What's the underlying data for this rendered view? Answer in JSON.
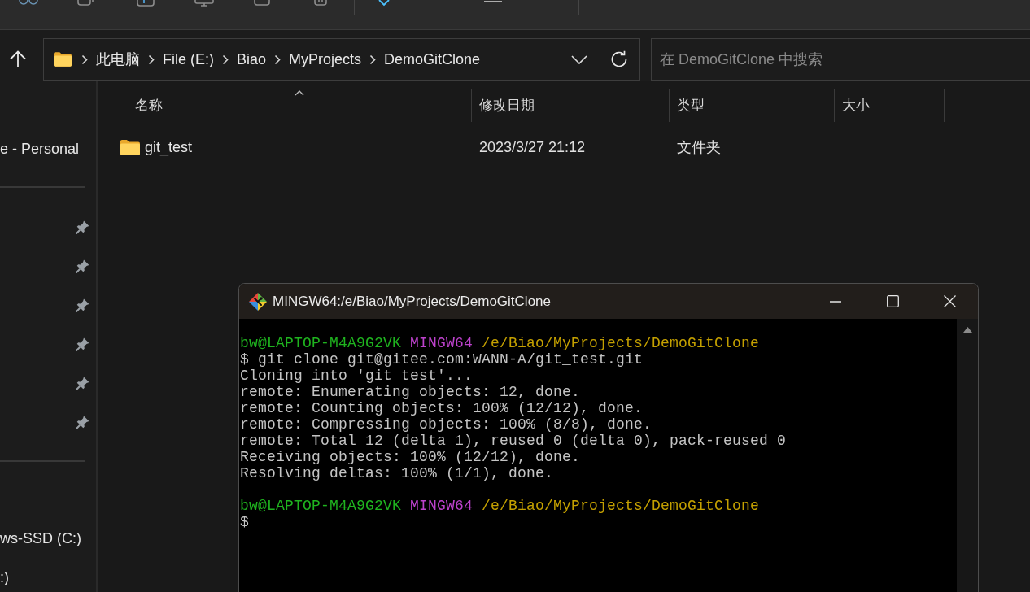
{
  "address_bar": {
    "breadcrumbs": [
      "此电脑",
      "File (E:)",
      "Biao",
      "MyProjects",
      "DemoGitClone"
    ]
  },
  "search": {
    "placeholder": "在 DemoGitClone 中搜索"
  },
  "sidebar": {
    "groups": [
      {
        "items": [
          {
            "label": "e - Personal"
          }
        ]
      },
      {
        "items": [
          {
            "pinned": true
          },
          {
            "pinned": true
          },
          {
            "pinned": true
          },
          {
            "pinned": true
          },
          {
            "pinned": true
          },
          {
            "pinned": true
          }
        ]
      },
      {
        "items": [
          {
            "label": "ws-SSD (C:)"
          },
          {
            "label": ":)"
          }
        ]
      }
    ]
  },
  "file_list": {
    "columns": [
      {
        "label": "名称",
        "sorted": true
      },
      {
        "label": "修改日期",
        "sorted": false
      },
      {
        "label": "类型",
        "sorted": false
      },
      {
        "label": "大小",
        "sorted": false
      }
    ],
    "rows": [
      {
        "kind": "folder",
        "name": "git_test",
        "modified": "2023/3/27 21:12",
        "type": "文件夹"
      }
    ]
  },
  "terminal": {
    "title": "MINGW64:/e/Biao/MyProjects/DemoGitClone",
    "lines": [
      {
        "kind": "prompt",
        "user": "bw@LAPTOP-M4A9G2VK",
        "shell": "MINGW64",
        "path": "/e/Biao/MyProjects/DemoGitClone"
      },
      {
        "kind": "text",
        "text": "$ git clone git@gitee.com:WANN-A/git_test.git"
      },
      {
        "kind": "text",
        "text": "Cloning into 'git_test'..."
      },
      {
        "kind": "text",
        "text": "remote: Enumerating objects: 12, done."
      },
      {
        "kind": "text",
        "text": "remote: Counting objects: 100% (12/12), done."
      },
      {
        "kind": "text",
        "text": "remote: Compressing objects: 100% (8/8), done."
      },
      {
        "kind": "text",
        "text": "remote: Total 12 (delta 1), reused 0 (delta 0), pack-reused 0"
      },
      {
        "kind": "text",
        "text": "Receiving objects: 100% (12/12), done."
      },
      {
        "kind": "text",
        "text": "Resolving deltas: 100% (1/1), done."
      },
      {
        "kind": "blank"
      },
      {
        "kind": "prompt",
        "user": "bw@LAPTOP-M4A9G2VK",
        "shell": "MINGW64",
        "path": "/e/Biao/MyProjects/DemoGitClone"
      },
      {
        "kind": "text",
        "text": "$"
      }
    ]
  }
}
